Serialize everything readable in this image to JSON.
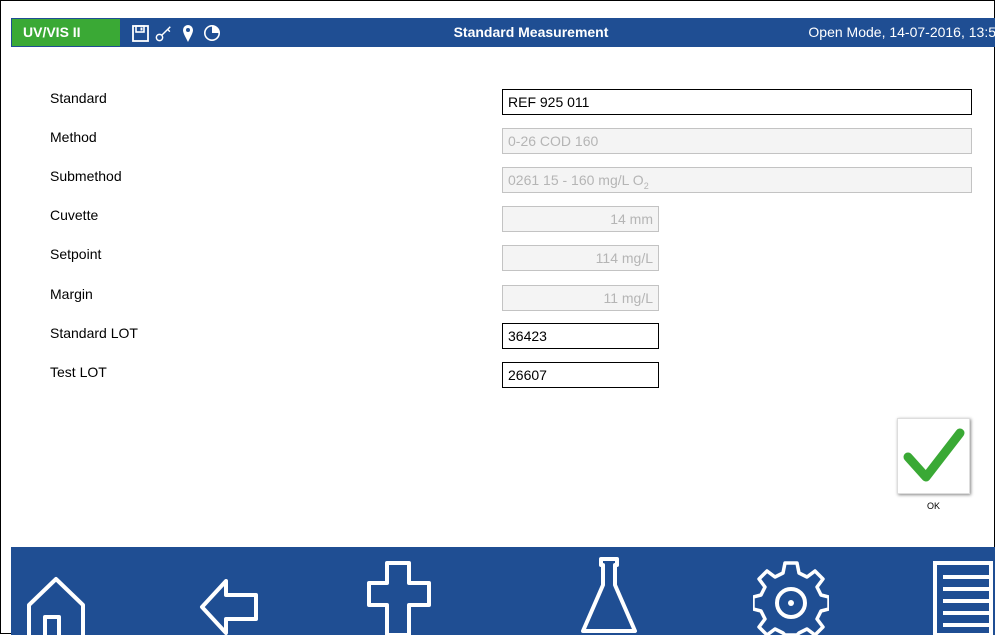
{
  "header": {
    "badge": "UV/VIS II",
    "title": "Standard Measurement",
    "mode": "Open Mode, 14-07-2016, 13:5",
    "icons": [
      "save-icon",
      "key-icon",
      "location-pin-icon",
      "pie-chart-icon"
    ]
  },
  "form": {
    "standard": {
      "label": "Standard",
      "value": "REF 925 011"
    },
    "method": {
      "label": "Method",
      "value": "0-26 COD 160"
    },
    "submethod": {
      "label": "Submethod",
      "value": "0261 15 - 160 mg/L O",
      "subscript": "2"
    },
    "cuvette": {
      "label": "Cuvette",
      "value": "14 mm"
    },
    "setpoint": {
      "label": "Setpoint",
      "value": "114 mg/L"
    },
    "margin": {
      "label": "Margin",
      "value": "11 mg/L"
    },
    "standard_lot": {
      "label": "Standard LOT",
      "value": "36423"
    },
    "test_lot": {
      "label": "Test LOT",
      "value": "26607"
    }
  },
  "ok_button": {
    "label": "OK",
    "icon": "checkmark-icon"
  },
  "nav_icons": [
    "home-icon",
    "back-arrow-icon",
    "add-icon",
    "flask-icon",
    "settings-gear-icon",
    "menu-list-icon"
  ],
  "colors": {
    "header_bg": "#1f4e93",
    "badge_bg": "#3aa935",
    "check_green": "#3aa935"
  }
}
